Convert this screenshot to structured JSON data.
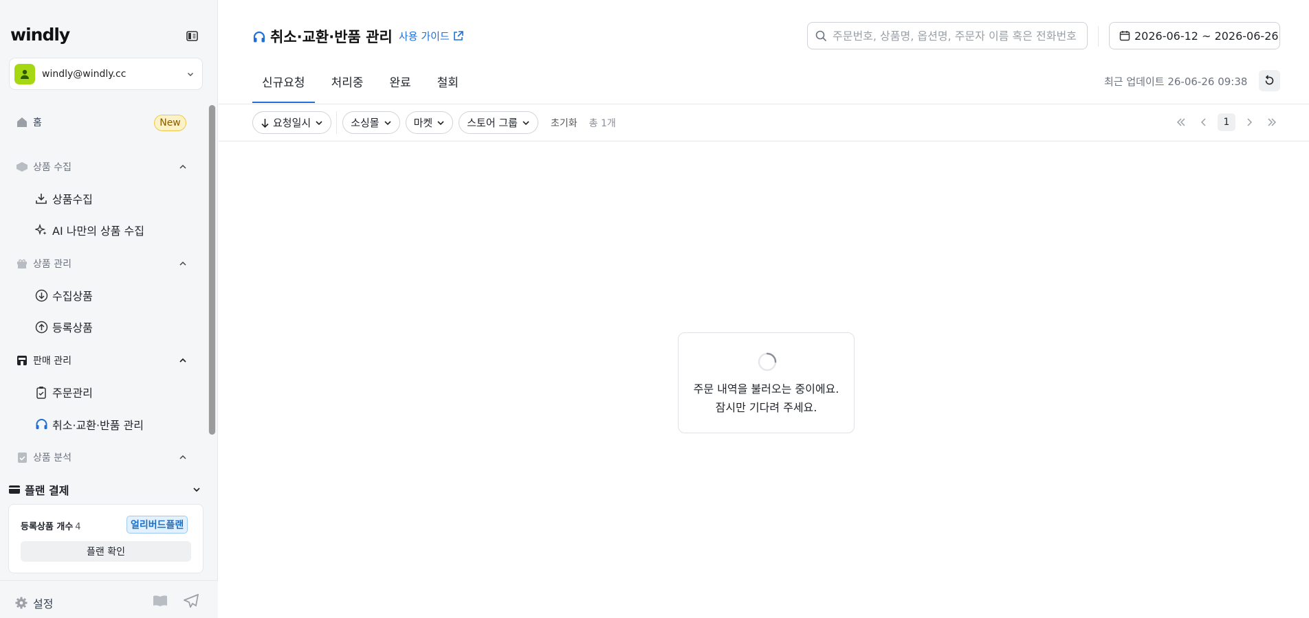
{
  "app": {
    "logo": "windly"
  },
  "account": {
    "email": "windly@windly.cc"
  },
  "sidebar": {
    "home": {
      "label": "홈",
      "badge": "New"
    },
    "sections": [
      {
        "label": "상품 수집",
        "items": [
          "상품수집",
          "AI 나만의 상품 수집"
        ]
      },
      {
        "label": "상품 관리",
        "items": [
          "수집상품",
          "등록상품"
        ]
      },
      {
        "label": "판매 관리",
        "items": [
          "주문관리",
          "취소·교환·반품 관리"
        ]
      },
      {
        "label": "상품 분석",
        "items": []
      }
    ],
    "plan": {
      "title": "플랜 결제",
      "count_label": "등록상품 개수",
      "count_value": "4",
      "badge": "얼리버드플랜",
      "button": "플랜 확인"
    },
    "settings": "설정"
  },
  "header": {
    "title": "취소·교환·반품 관리",
    "guide": "사용 가이드",
    "search_placeholder": "주문번호, 상품명, 옵션명, 주문자 이름 혹은 전화번호",
    "date_range": "2026-06-12 ~ 2026-06-26"
  },
  "tabs": [
    "신규요청",
    "처리중",
    "완료",
    "철회"
  ],
  "updated": "최근 업데이트 26-06-26 09:38",
  "filters": {
    "sort": "요청일시",
    "chips": [
      "소싱몰",
      "마켓",
      "스토어 그룹"
    ],
    "reset": "초기화",
    "total": "총 1개"
  },
  "pager": {
    "current": "1"
  },
  "loading": {
    "line1": "주문 내역을 불러오는 중이에요.",
    "line2": "잠시만 기다려 주세요."
  },
  "colors": {
    "accent": "#1e6fd9",
    "avatar": "#a6d713"
  }
}
